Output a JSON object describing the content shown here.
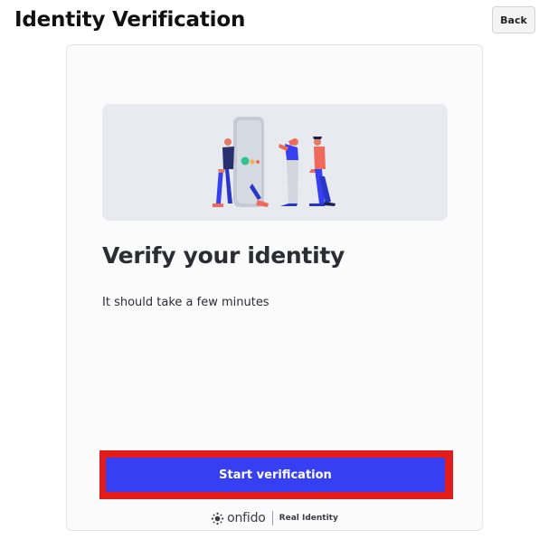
{
  "header": {
    "title": "Identity Verification",
    "back_label": "Back"
  },
  "card": {
    "heading": "Verify your identity",
    "subtitle": "It should take a few minutes",
    "start_label": "Start verification"
  },
  "footer": {
    "brand": "onfido",
    "tagline": "Real Identity"
  },
  "colors": {
    "primary_button": "#3640f2",
    "highlight_border": "#e21b1b",
    "illustration_background": "#e7eaef"
  },
  "icons": {
    "illustration": "people-with-phone-illustration",
    "brand_logo": "onfido-logo-icon"
  }
}
